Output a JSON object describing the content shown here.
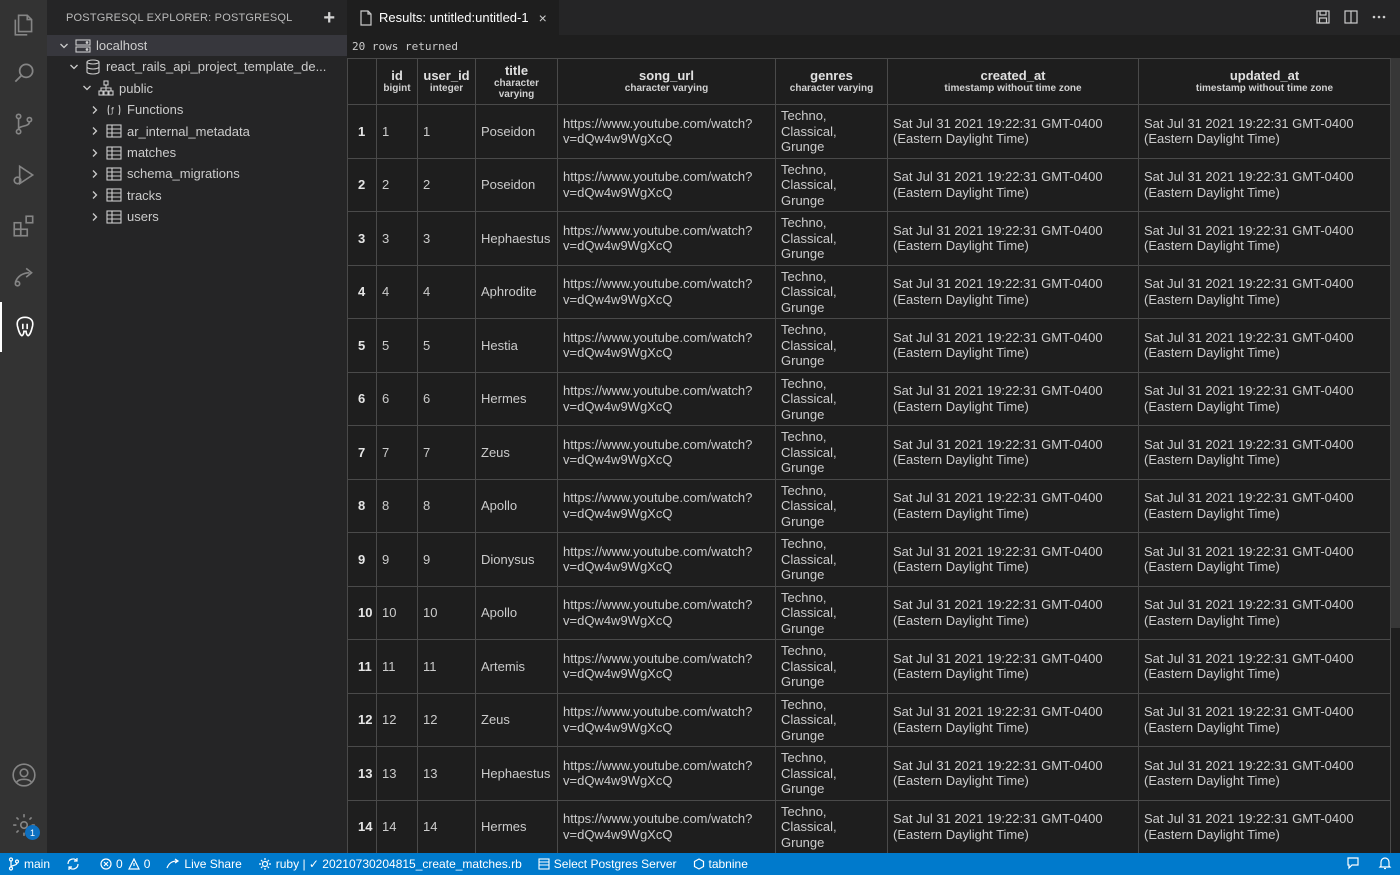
{
  "sidebar": {
    "title": "POSTGRESQL EXPLORER: POSTGRESQL",
    "add_icon": "plus-icon",
    "tree": [
      {
        "label": "localhost",
        "depth": 0,
        "expanded": true,
        "icon": "server-icon"
      },
      {
        "label": "react_rails_api_project_template_de...",
        "depth": 1,
        "expanded": true,
        "icon": "database-icon"
      },
      {
        "label": "public",
        "depth": 2,
        "expanded": true,
        "icon": "schema-icon"
      },
      {
        "label": "Functions",
        "depth": 3,
        "expanded": false,
        "icon": "functions-icon"
      },
      {
        "label": "ar_internal_metadata",
        "depth": 3,
        "expanded": false,
        "icon": "table-icon"
      },
      {
        "label": "matches",
        "depth": 3,
        "expanded": false,
        "icon": "table-icon"
      },
      {
        "label": "schema_migrations",
        "depth": 3,
        "expanded": false,
        "icon": "table-icon"
      },
      {
        "label": "tracks",
        "depth": 3,
        "expanded": false,
        "icon": "table-icon"
      },
      {
        "label": "users",
        "depth": 3,
        "expanded": false,
        "icon": "table-icon"
      }
    ]
  },
  "tab": {
    "label": "Results: untitled:untitled-1",
    "close": "×"
  },
  "results": {
    "summary": "20 rows returned",
    "columns": [
      {
        "name": "",
        "type": ""
      },
      {
        "name": "id",
        "type": "bigint"
      },
      {
        "name": "user_id",
        "type": "integer"
      },
      {
        "name": "title",
        "type": "character varying"
      },
      {
        "name": "song_url",
        "type": "character varying"
      },
      {
        "name": "genres",
        "type": "character varying"
      },
      {
        "name": "created_at",
        "type": "timestamp without time zone"
      },
      {
        "name": "updated_at",
        "type": "timestamp without time zone"
      }
    ],
    "rows": [
      {
        "n": "1",
        "id": "1",
        "user_id": "1",
        "title": "Poseidon",
        "song_url": "https://www.youtube.com/watch?\nv=dQw4w9WgXcQ",
        "genres": "Techno,\nClassical,\nGrunge",
        "created_at": "Sat Jul 31 2021 19:22:31 GMT-0400\n(Eastern Daylight Time)",
        "updated_at": "Sat Jul 31 2021 19:22:31 GMT-0400\n(Eastern Daylight Time)"
      },
      {
        "n": "2",
        "id": "2",
        "user_id": "2",
        "title": "Poseidon",
        "song_url": "https://www.youtube.com/watch?\nv=dQw4w9WgXcQ",
        "genres": "Techno,\nClassical,\nGrunge",
        "created_at": "Sat Jul 31 2021 19:22:31 GMT-0400\n(Eastern Daylight Time)",
        "updated_at": "Sat Jul 31 2021 19:22:31 GMT-0400\n(Eastern Daylight Time)"
      },
      {
        "n": "3",
        "id": "3",
        "user_id": "3",
        "title": "Hephaestus",
        "song_url": "https://www.youtube.com/watch?\nv=dQw4w9WgXcQ",
        "genres": "Techno,\nClassical,\nGrunge",
        "created_at": "Sat Jul 31 2021 19:22:31 GMT-0400\n(Eastern Daylight Time)",
        "updated_at": "Sat Jul 31 2021 19:22:31 GMT-0400\n(Eastern Daylight Time)"
      },
      {
        "n": "4",
        "id": "4",
        "user_id": "4",
        "title": "Aphrodite",
        "song_url": "https://www.youtube.com/watch?\nv=dQw4w9WgXcQ",
        "genres": "Techno,\nClassical,\nGrunge",
        "created_at": "Sat Jul 31 2021 19:22:31 GMT-0400\n(Eastern Daylight Time)",
        "updated_at": "Sat Jul 31 2021 19:22:31 GMT-0400\n(Eastern Daylight Time)"
      },
      {
        "n": "5",
        "id": "5",
        "user_id": "5",
        "title": "Hestia",
        "song_url": "https://www.youtube.com/watch?\nv=dQw4w9WgXcQ",
        "genres": "Techno,\nClassical,\nGrunge",
        "created_at": "Sat Jul 31 2021 19:22:31 GMT-0400\n(Eastern Daylight Time)",
        "updated_at": "Sat Jul 31 2021 19:22:31 GMT-0400\n(Eastern Daylight Time)"
      },
      {
        "n": "6",
        "id": "6",
        "user_id": "6",
        "title": "Hermes",
        "song_url": "https://www.youtube.com/watch?\nv=dQw4w9WgXcQ",
        "genres": "Techno,\nClassical,\nGrunge",
        "created_at": "Sat Jul 31 2021 19:22:31 GMT-0400\n(Eastern Daylight Time)",
        "updated_at": "Sat Jul 31 2021 19:22:31 GMT-0400\n(Eastern Daylight Time)"
      },
      {
        "n": "7",
        "id": "7",
        "user_id": "7",
        "title": "Zeus",
        "song_url": "https://www.youtube.com/watch?\nv=dQw4w9WgXcQ",
        "genres": "Techno,\nClassical,\nGrunge",
        "created_at": "Sat Jul 31 2021 19:22:31 GMT-0400\n(Eastern Daylight Time)",
        "updated_at": "Sat Jul 31 2021 19:22:31 GMT-0400\n(Eastern Daylight Time)"
      },
      {
        "n": "8",
        "id": "8",
        "user_id": "8",
        "title": "Apollo",
        "song_url": "https://www.youtube.com/watch?\nv=dQw4w9WgXcQ",
        "genres": "Techno,\nClassical,\nGrunge",
        "created_at": "Sat Jul 31 2021 19:22:31 GMT-0400\n(Eastern Daylight Time)",
        "updated_at": "Sat Jul 31 2021 19:22:31 GMT-0400\n(Eastern Daylight Time)"
      },
      {
        "n": "9",
        "id": "9",
        "user_id": "9",
        "title": "Dionysus",
        "song_url": "https://www.youtube.com/watch?\nv=dQw4w9WgXcQ",
        "genres": "Techno,\nClassical,\nGrunge",
        "created_at": "Sat Jul 31 2021 19:22:31 GMT-0400\n(Eastern Daylight Time)",
        "updated_at": "Sat Jul 31 2021 19:22:31 GMT-0400\n(Eastern Daylight Time)"
      },
      {
        "n": "10",
        "id": "10",
        "user_id": "10",
        "title": "Apollo",
        "song_url": "https://www.youtube.com/watch?\nv=dQw4w9WgXcQ",
        "genres": "Techno,\nClassical,\nGrunge",
        "created_at": "Sat Jul 31 2021 19:22:31 GMT-0400\n(Eastern Daylight Time)",
        "updated_at": "Sat Jul 31 2021 19:22:31 GMT-0400\n(Eastern Daylight Time)"
      },
      {
        "n": "11",
        "id": "11",
        "user_id": "11",
        "title": "Artemis",
        "song_url": "https://www.youtube.com/watch?\nv=dQw4w9WgXcQ",
        "genres": "Techno,\nClassical,\nGrunge",
        "created_at": "Sat Jul 31 2021 19:22:31 GMT-0400\n(Eastern Daylight Time)",
        "updated_at": "Sat Jul 31 2021 19:22:31 GMT-0400\n(Eastern Daylight Time)"
      },
      {
        "n": "12",
        "id": "12",
        "user_id": "12",
        "title": "Zeus",
        "song_url": "https://www.youtube.com/watch?\nv=dQw4w9WgXcQ",
        "genres": "Techno,\nClassical,\nGrunge",
        "created_at": "Sat Jul 31 2021 19:22:31 GMT-0400\n(Eastern Daylight Time)",
        "updated_at": "Sat Jul 31 2021 19:22:31 GMT-0400\n(Eastern Daylight Time)"
      },
      {
        "n": "13",
        "id": "13",
        "user_id": "13",
        "title": "Hephaestus",
        "song_url": "https://www.youtube.com/watch?\nv=dQw4w9WgXcQ",
        "genres": "Techno,\nClassical,\nGrunge",
        "created_at": "Sat Jul 31 2021 19:22:31 GMT-0400\n(Eastern Daylight Time)",
        "updated_at": "Sat Jul 31 2021 19:22:31 GMT-0400\n(Eastern Daylight Time)"
      },
      {
        "n": "14",
        "id": "14",
        "user_id": "14",
        "title": "Hermes",
        "song_url": "https://www.youtube.com/watch?\nv=dQw4w9WgXcQ",
        "genres": "Techno,\nClassical,\nGrunge",
        "created_at": "Sat Jul 31 2021 19:22:31 GMT-0400\n(Eastern Daylight Time)",
        "updated_at": "Sat Jul 31 2021 19:22:31 GMT-0400\n(Eastern Daylight Time)"
      }
    ]
  },
  "statusbar": {
    "branch": "main",
    "errors": "0",
    "warnings": "0",
    "live_share": "Live Share",
    "ruby": "ruby | ✓ 20210730204815_create_matches.rb",
    "postgres": "Select Postgres Server",
    "tabnine": "tabnine"
  },
  "activity_bar": {
    "items": [
      "explorer-icon",
      "search-icon",
      "source-control-icon",
      "run-debug-icon",
      "extensions-icon",
      "live-share-icon",
      "postgresql-icon"
    ],
    "bottom": [
      "account-icon",
      "settings-gear-icon"
    ],
    "settings_badge": "1"
  },
  "colors": {
    "statusbar": "#007acc",
    "sidebar": "#252526",
    "editor": "#1e1e1e",
    "activity_bar": "#333333"
  }
}
